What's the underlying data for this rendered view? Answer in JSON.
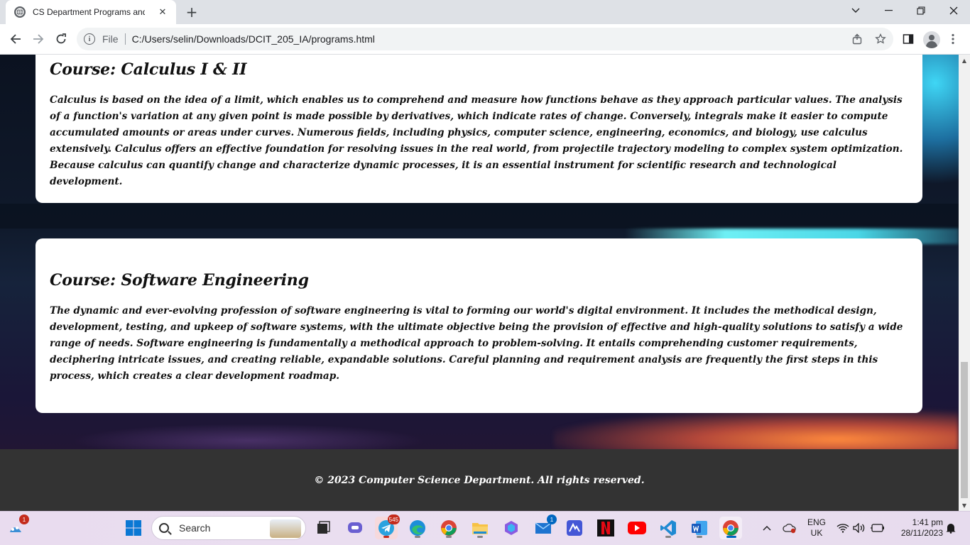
{
  "browser": {
    "tab_title": "CS Department Programs and C",
    "url_scheme": "File",
    "url": "C:/Users/selin/Downloads/DCIT_205_IA/programs.html"
  },
  "courses": [
    {
      "title": "Course: Calculus I & II",
      "description": "Calculus is based on the idea of a limit, which enables us to comprehend and measure how functions behave as they approach particular values. The analysis of a function's variation at any given point is made possible by derivatives, which indicate rates of change. Conversely, integrals make it easier to compute accumulated amounts or areas under curves. Numerous fields, including physics, computer science, engineering, economics, and biology, use calculus extensively. Calculus offers an effective foundation for resolving issues in the real world, from projectile trajectory modeling to complex system optimization. Because calculus can quantify change and characterize dynamic processes, it is an essential instrument for scientific research and technological development."
    },
    {
      "title": "Course: Software Engineering",
      "description": "The dynamic and ever-evolving profession of software engineering is vital to forming our world's digital environment. It includes the methodical design, development, testing, and upkeep of software systems, with the ultimate objective being the provision of effective and high-quality solutions to satisfy a wide range of needs. Software engineering is fundamentally a methodical approach to problem-solving. It entails comprehending customer requirements, deciphering intricate issues, and creating reliable, expandable solutions. Careful planning and requirement analysis are frequently the first steps in this process, which creates a clear development roadmap."
    }
  ],
  "footer": {
    "text": "© 2023 Computer Science Department. All rights reserved."
  },
  "taskbar": {
    "search_label": "Search",
    "widgets_badge": "1",
    "telegram_badge": "545",
    "mail_badge": "1",
    "lang_primary": "ENG",
    "lang_secondary": "UK",
    "time": "1:41 pm",
    "date": "28/11/2023",
    "apps": [
      "widgets-icon",
      "start-icon",
      "search-icon",
      "task-view-icon",
      "teams-chat-icon",
      "telegram-icon",
      "edge-icon",
      "chrome-icon",
      "file-explorer-icon",
      "copilot-icon",
      "mail-icon",
      "ms-todo-icon",
      "netflix-icon",
      "youtube-icon",
      "vscode-icon",
      "word-icon",
      "chrome-active-icon"
    ]
  },
  "colors": {
    "card_bg": "#ffffff",
    "footer_bg": "#333333",
    "footer_text": "#ffffff",
    "accent_blue": "#0067c0"
  }
}
